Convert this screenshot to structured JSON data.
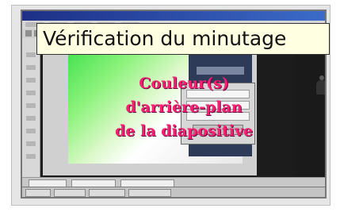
{
  "tooltip": {
    "text": "Vérification du minutage"
  },
  "slide_overlay": {
    "line1": "Couleur(s)",
    "line2": "d'arrière-plan",
    "line3": "de la diapositive"
  },
  "colors": {
    "tooltip_bg": "#ffffe1",
    "accent_pink": "#ff1f72",
    "titlebar_blue": "#1d2f86",
    "slide_green": "#3ee04b"
  }
}
